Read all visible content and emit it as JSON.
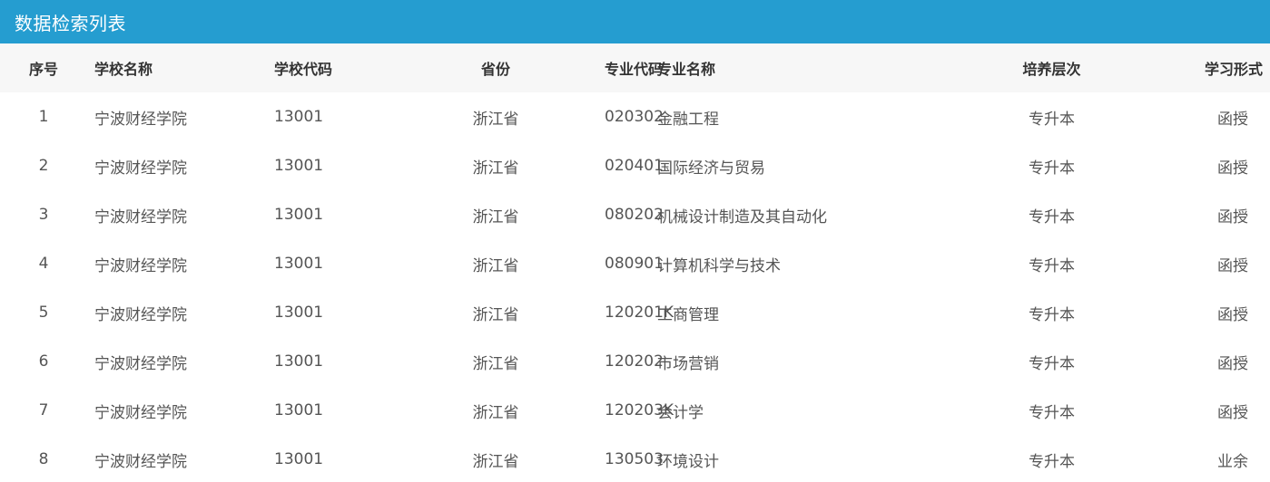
{
  "header": {
    "title": "数据检索列表"
  },
  "columns": {
    "index": "序号",
    "school_name": "学校名称",
    "school_code": "学校代码",
    "province": "省份",
    "major_code": "专业代码",
    "major_name": "专业名称",
    "level": "培养层次",
    "study_form": "学习形式"
  },
  "rows": [
    {
      "index": "1",
      "school_name": "宁波财经学院",
      "school_code": "13001",
      "province": "浙江省",
      "major_code": "020302",
      "major_name": "金融工程",
      "level": "专升本",
      "study_form": "函授"
    },
    {
      "index": "2",
      "school_name": "宁波财经学院",
      "school_code": "13001",
      "province": "浙江省",
      "major_code": "020401",
      "major_name": "国际经济与贸易",
      "level": "专升本",
      "study_form": "函授"
    },
    {
      "index": "3",
      "school_name": "宁波财经学院",
      "school_code": "13001",
      "province": "浙江省",
      "major_code": "080202",
      "major_name": "机械设计制造及其自动化",
      "level": "专升本",
      "study_form": "函授"
    },
    {
      "index": "4",
      "school_name": "宁波财经学院",
      "school_code": "13001",
      "province": "浙江省",
      "major_code": "080901",
      "major_name": "计算机科学与技术",
      "level": "专升本",
      "study_form": "函授"
    },
    {
      "index": "5",
      "school_name": "宁波财经学院",
      "school_code": "13001",
      "province": "浙江省",
      "major_code": "120201K",
      "major_name": "工商管理",
      "level": "专升本",
      "study_form": "函授"
    },
    {
      "index": "6",
      "school_name": "宁波财经学院",
      "school_code": "13001",
      "province": "浙江省",
      "major_code": "120202",
      "major_name": "市场营销",
      "level": "专升本",
      "study_form": "函授"
    },
    {
      "index": "7",
      "school_name": "宁波财经学院",
      "school_code": "13001",
      "province": "浙江省",
      "major_code": "120203K",
      "major_name": "会计学",
      "level": "专升本",
      "study_form": "函授"
    },
    {
      "index": "8",
      "school_name": "宁波财经学院",
      "school_code": "13001",
      "province": "浙江省",
      "major_code": "130503",
      "major_name": "环境设计",
      "level": "专升本",
      "study_form": "业余"
    }
  ]
}
